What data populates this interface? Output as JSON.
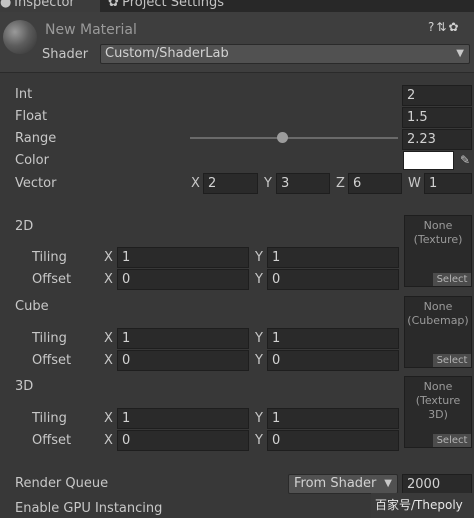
{
  "tabs": [
    {
      "label": "Inspector",
      "icon": "info-icon"
    },
    {
      "label": "Project Settings",
      "icon": "gear-icon"
    }
  ],
  "material": {
    "name": "New Material",
    "header_icons": [
      "help-icon",
      "preset-icon",
      "gear-icon"
    ],
    "shader_label": "Shader",
    "shader_value": "Custom/ShaderLab"
  },
  "properties": {
    "int": {
      "label": "Int",
      "value": "2"
    },
    "float": {
      "label": "Float",
      "value": "1.5"
    },
    "range": {
      "label": "Range",
      "value": "2.23",
      "slider_fraction": 0.44
    },
    "color": {
      "label": "Color",
      "value_hex": "#ffffff"
    },
    "vector": {
      "label": "Vector",
      "x": "2",
      "y": "3",
      "z": "6",
      "w": "1",
      "x_axis": "X",
      "y_axis": "Y",
      "z_axis": "Z",
      "w_axis": "W"
    }
  },
  "textures": [
    {
      "label": "2D",
      "tiling_label": "Tiling",
      "offset_label": "Offset",
      "tiling_x": "1",
      "tiling_y": "1",
      "offset_x": "0",
      "offset_y": "0",
      "slot_none": "None",
      "slot_type": "(Texture)",
      "select_label": "Select"
    },
    {
      "label": "Cube",
      "tiling_label": "Tiling",
      "offset_label": "Offset",
      "tiling_x": "1",
      "tiling_y": "1",
      "offset_x": "0",
      "offset_y": "0",
      "slot_none": "None",
      "slot_type": "(Cubemap)",
      "select_label": "Select"
    },
    {
      "label": "3D",
      "tiling_label": "Tiling",
      "offset_label": "Offset",
      "tiling_x": "1",
      "tiling_y": "1",
      "offset_x": "0",
      "offset_y": "0",
      "slot_none": "None",
      "slot_type": "(Texture 3D)",
      "select_label": "Select"
    }
  ],
  "axes": {
    "x": "X",
    "y": "Y"
  },
  "render_queue": {
    "label": "Render Queue",
    "mode": "From Shader",
    "value": "2000"
  },
  "gpu_instancing": {
    "label": "Enable GPU Instancing"
  },
  "watermark": "百家号/Thepoly"
}
